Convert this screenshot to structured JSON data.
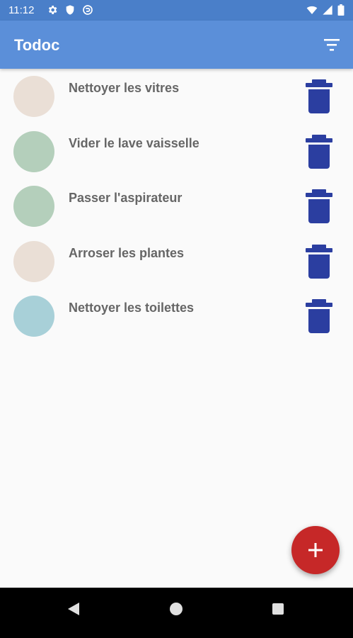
{
  "status_bar": {
    "time": "11:12",
    "icons_left": [
      "settings-icon",
      "shield-icon",
      "vpn-icon"
    ],
    "icons_right": [
      "wifi-icon",
      "cell-signal-icon",
      "battery-icon"
    ]
  },
  "app_bar": {
    "title": "Todoc",
    "filter_icon": "filter-list-icon",
    "color": "#5b8fd9"
  },
  "tasks": [
    {
      "name": "Nettoyer les vitres",
      "project_color": "#eadfd6"
    },
    {
      "name": "Vider le lave vaisselle",
      "project_color": "#b4cfbb"
    },
    {
      "name": "Passer l'aspirateur",
      "project_color": "#b4cfbb"
    },
    {
      "name": "Arroser les plantes",
      "project_color": "#eadfd6"
    },
    {
      "name": "Nettoyer les toilettes",
      "project_color": "#a8d0d8"
    }
  ],
  "delete_icon": {
    "name": "trash-icon",
    "color": "#2b3ea0"
  },
  "fab": {
    "icon": "plus-icon",
    "color": "#c62828"
  },
  "nav_bar": {
    "icons": [
      "back-icon",
      "home-icon",
      "recents-icon"
    ]
  }
}
